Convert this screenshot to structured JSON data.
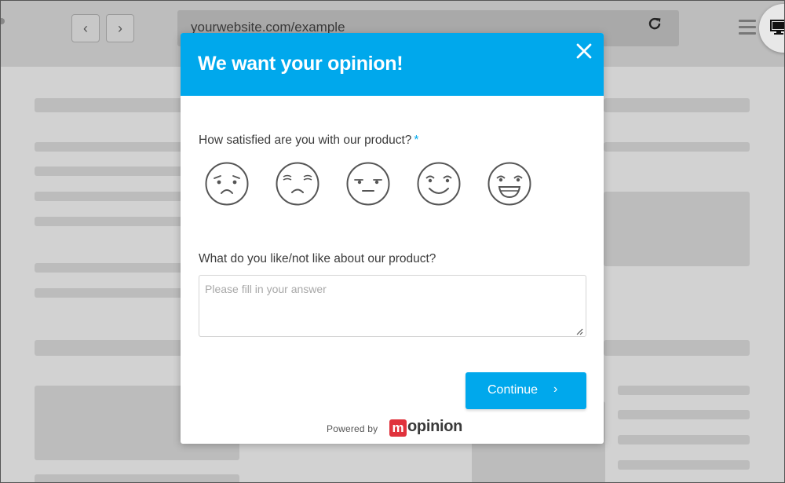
{
  "browser": {
    "back_icon": "chevron-left-icon",
    "forward_icon": "chevron-right-icon",
    "url": "yourwebsite.com/example",
    "reload_icon": "reload-icon",
    "menu_icon": "hamburger-menu-icon",
    "device_icon": "desktop-monitor-icon"
  },
  "survey": {
    "title": "We want your opinion!",
    "close_icon": "close-icon",
    "question1": {
      "label": "How satisfied are you with our product?",
      "required_mark": "*",
      "options": [
        "very-unsatisfied-face",
        "unsatisfied-face",
        "neutral-face",
        "satisfied-face",
        "very-satisfied-face"
      ]
    },
    "question2": {
      "label": "What do you like/not like about our product?",
      "placeholder": "Please fill in your answer",
      "value": ""
    },
    "continue_label": "Continue",
    "continue_icon": "chevron-right-icon",
    "powered_by": "Powered by",
    "brand_m": "m",
    "brand_rest": "opinion"
  },
  "colors": {
    "accent": "#00a8ec",
    "brand_red": "#e0323c",
    "overlay_bg": "#d2d2d2"
  }
}
